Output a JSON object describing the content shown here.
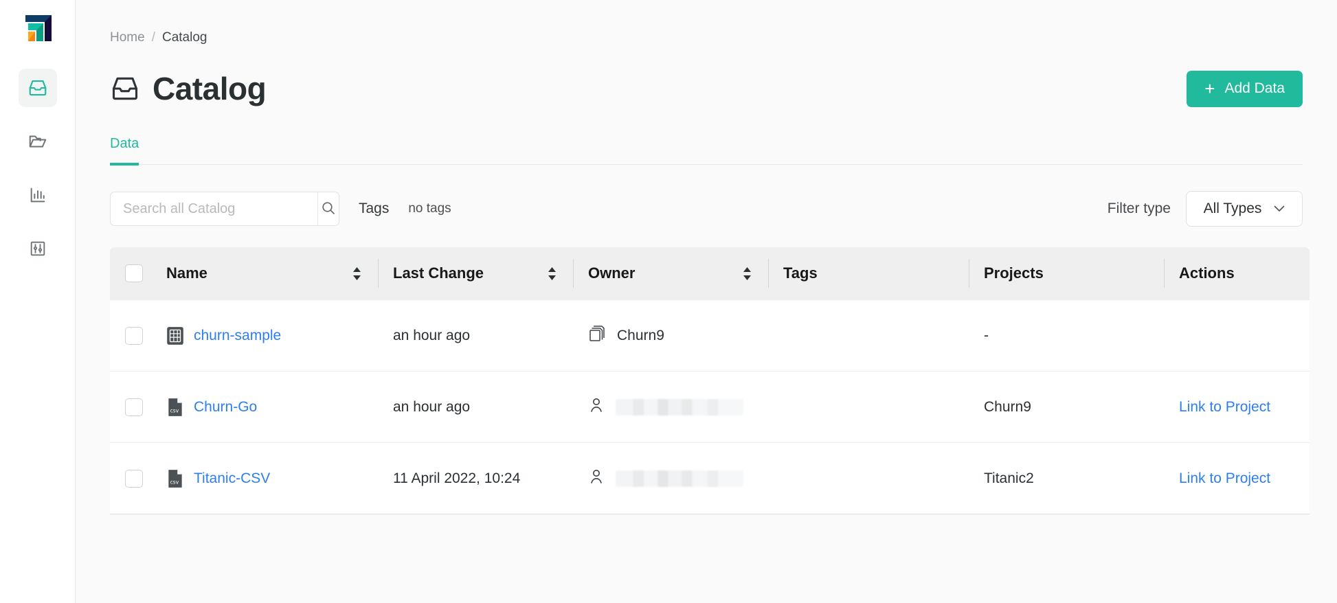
{
  "brand": {
    "logo_name": "company-logo",
    "accent_teal": "#21ba9c",
    "link_blue": "#2d7ff0",
    "logo_navy": "#0d3c66",
    "logo_dark": "#140a3c",
    "logo_orange": "#f99a1c"
  },
  "sidebar": {
    "items": [
      {
        "name": "catalog",
        "icon": "inbox-tray-icon",
        "active": true
      },
      {
        "name": "projects",
        "icon": "folder-icon",
        "active": false
      },
      {
        "name": "analytics",
        "icon": "bar-chart-icon",
        "active": false
      },
      {
        "name": "settings",
        "icon": "sliders-icon",
        "active": false
      }
    ]
  },
  "breadcrumb": {
    "home": "Home",
    "separator": "/",
    "current": "Catalog"
  },
  "header": {
    "title": "Catalog",
    "title_icon": "inbox-tray-icon",
    "add_button": {
      "label": "Add Data",
      "plus": "+"
    }
  },
  "tabs": [
    {
      "label": "Data",
      "active": true
    }
  ],
  "toolbar": {
    "search_placeholder": "Search all Catalog",
    "search_value": "",
    "search_icon": "search-icon",
    "tags_label": "Tags",
    "tags_value": "no tags",
    "filter_label": "Filter type",
    "filter_value": "All Types",
    "filter_chevron": "⌄"
  },
  "table": {
    "columns": [
      {
        "key": "name",
        "label": "Name",
        "sortable": true
      },
      {
        "key": "date",
        "label": "Last Change",
        "sortable": true
      },
      {
        "key": "owner",
        "label": "Owner",
        "sortable": true
      },
      {
        "key": "tags",
        "label": "Tags",
        "sortable": false
      },
      {
        "key": "projects",
        "label": "Projects",
        "sortable": false
      },
      {
        "key": "actions",
        "label": "Actions",
        "sortable": false
      }
    ],
    "rows": [
      {
        "name": "churn-sample",
        "name_icon": "table-grid-icon",
        "date": "an hour ago",
        "owner": "Churn9",
        "owner_icon": "stacked-copies-icon",
        "owner_blurred": false,
        "tags": "",
        "projects": "-",
        "action_link": "",
        "menu_icon": "vertical-dots-icon"
      },
      {
        "name": "Churn-Go",
        "name_icon": "csv-file-icon",
        "date": "an hour ago",
        "owner": "",
        "owner_icon": "person-icon",
        "owner_blurred": true,
        "tags": "",
        "projects": "Churn9",
        "action_link": "Link to Project",
        "menu_icon": "vertical-dots-icon"
      },
      {
        "name": "Titanic-CSV",
        "name_icon": "csv-file-icon",
        "date": "11 April 2022, 10:24",
        "owner": "",
        "owner_icon": "person-icon",
        "owner_blurred": true,
        "tags": "",
        "projects": "Titanic2",
        "action_link": "Link to Project",
        "menu_icon": "vertical-dots-icon"
      }
    ]
  }
}
